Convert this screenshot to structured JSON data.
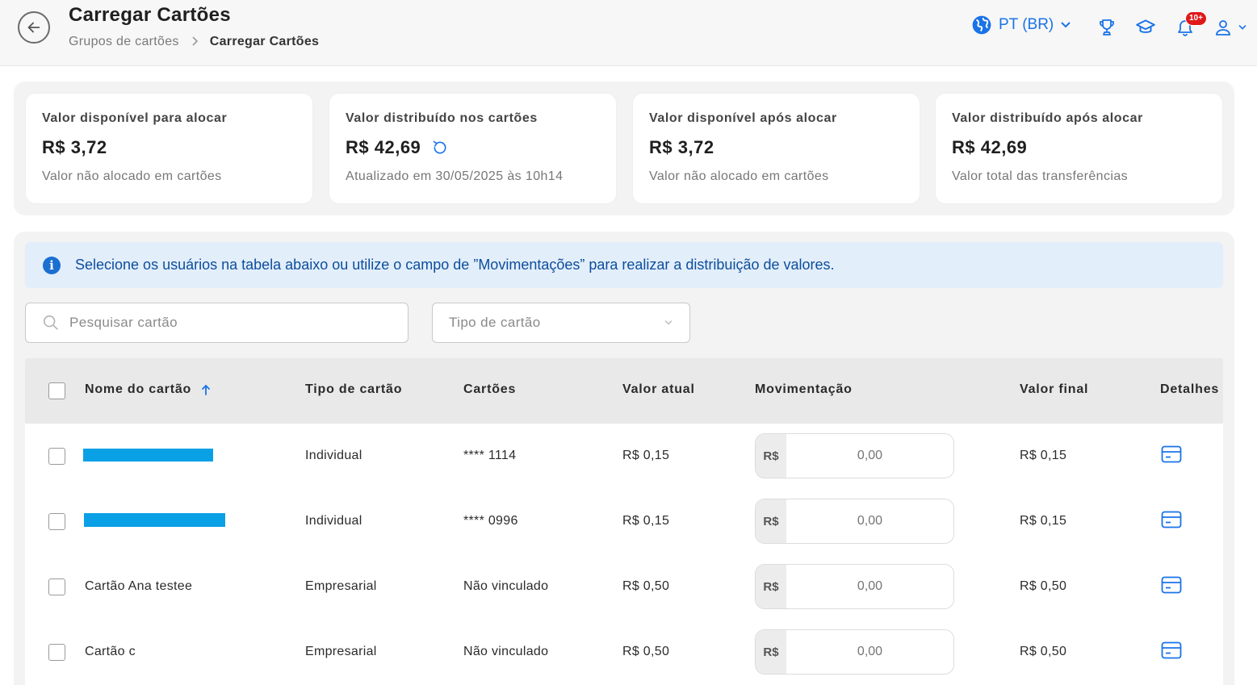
{
  "header": {
    "title": "Carregar Cartões",
    "breadcrumb": {
      "parent": "Grupos de cartões",
      "current": "Carregar Cartões"
    },
    "language": "PT (BR)",
    "notifications_badge": "10+"
  },
  "summary": [
    {
      "label": "Valor disponível para alocar",
      "value": "R$ 3,72",
      "sub": "Valor não alocado em cartões"
    },
    {
      "label": "Valor distribuído nos cartões",
      "value": "R$ 42,69",
      "sub": "Atualizado em 30/05/2025 às 10h14"
    },
    {
      "label": "Valor disponível após alocar",
      "value": "R$ 3,72",
      "sub": "Valor não alocado em cartões"
    },
    {
      "label": "Valor distribuído após alocar",
      "value": "R$ 42,69",
      "sub": "Valor total das transferências"
    }
  ],
  "info_message": "Selecione os usuários na tabela abaixo ou utilize o campo de ”Movimentações” para realizar a distribuição de valores.",
  "filters": {
    "search_placeholder": "Pesquisar cartão",
    "type_placeholder": "Tipo de cartão"
  },
  "table": {
    "columns": [
      "Nome do cartão",
      "Tipo de cartão",
      "Cartões",
      "Valor atual",
      "Movimentação",
      "Valor final",
      "Detalhes"
    ],
    "currency_prefix": "R$",
    "amount_placeholder": "0,00",
    "rows": [
      {
        "name": "",
        "type": "Individual",
        "card": "**** 1114",
        "current": "R$ 0,15",
        "final": "R$ 0,15"
      },
      {
        "name": "",
        "type": "Individual",
        "card": "**** 0996",
        "current": "R$ 0,15",
        "final": "R$ 0,15"
      },
      {
        "name": "Cartão Ana testee",
        "type": "Empresarial",
        "card": "Não vinculado",
        "current": "R$ 0,50",
        "final": "R$ 0,50"
      },
      {
        "name": "Cartão c",
        "type": "Empresarial",
        "card": "Não vinculado",
        "current": "R$ 0,50",
        "final": "R$ 0,50"
      }
    ]
  },
  "colors": {
    "accent": "#1a73e8",
    "redaction": "#0aa0e6",
    "badge": "#e01919",
    "info_bg": "#e3eefb"
  }
}
